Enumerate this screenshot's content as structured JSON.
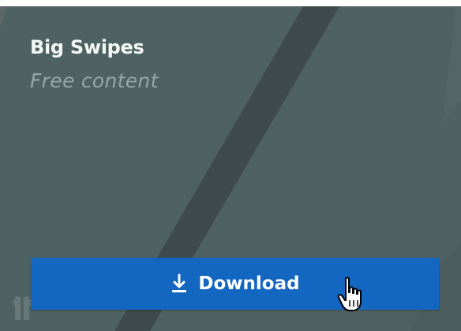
{
  "card": {
    "title": "Big Swipes",
    "subtitle": "Free content",
    "background_color": "#4f6263",
    "stripe_color": "#3e4a4c",
    "icons": {
      "corner": "gift-icon"
    }
  },
  "download_button": {
    "label": "Download",
    "icon": "download-icon",
    "color": "#1467c0"
  },
  "cursor": {
    "icon": "hand-pointer-icon"
  }
}
